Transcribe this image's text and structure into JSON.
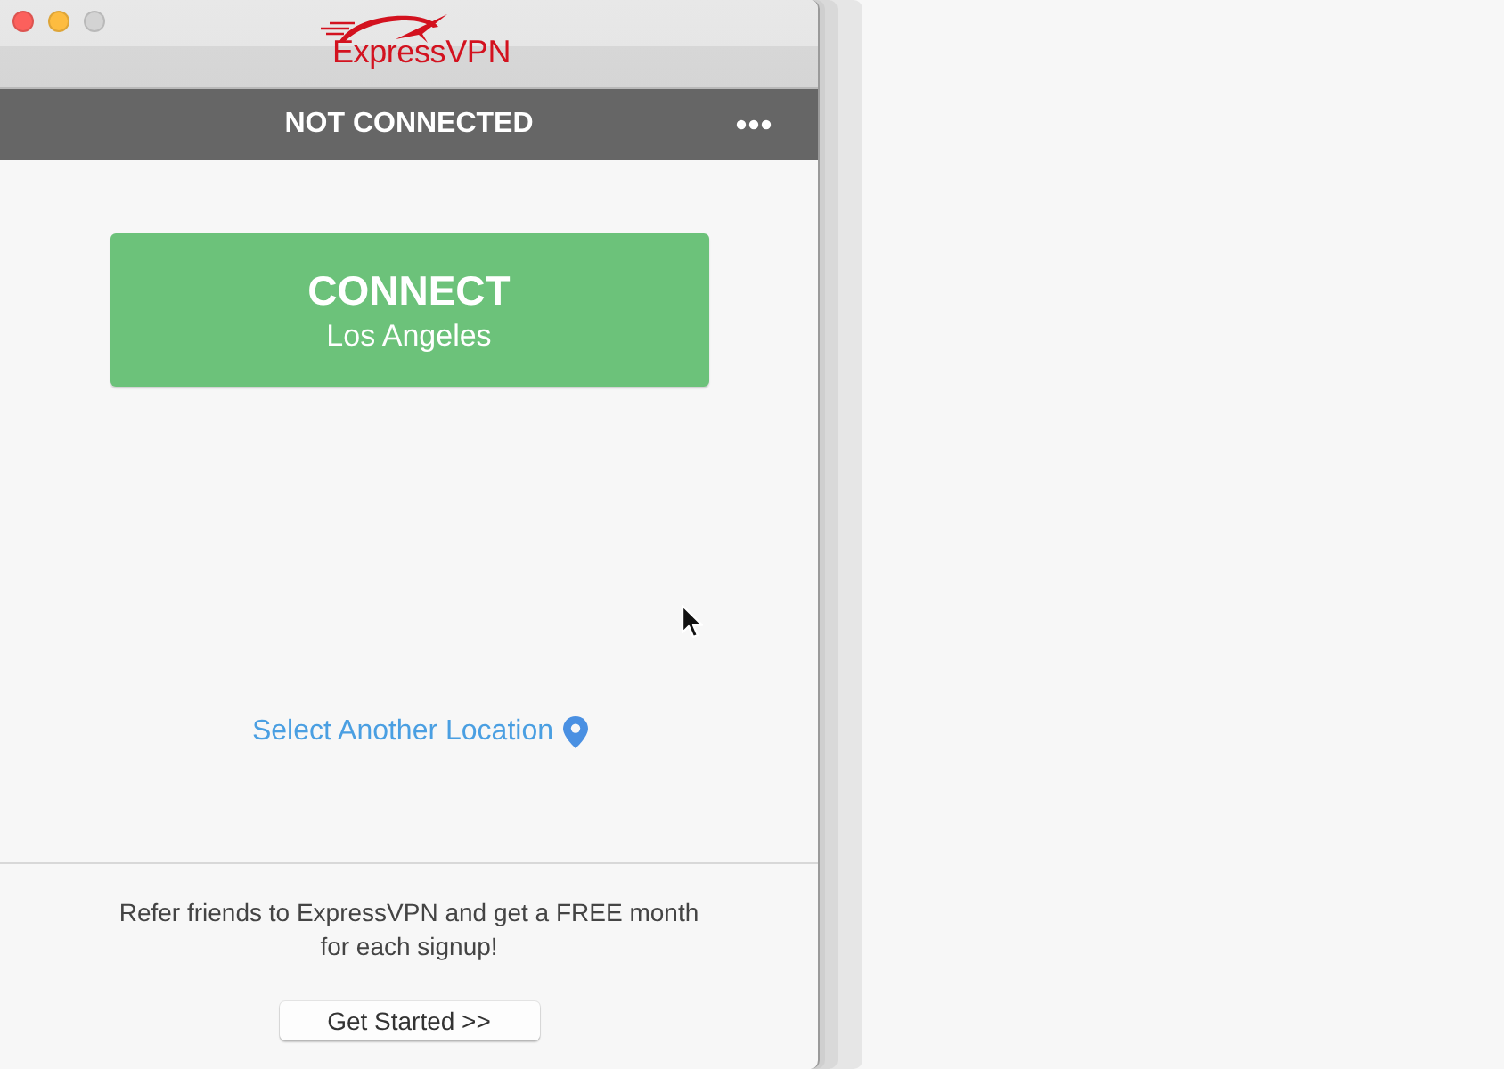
{
  "window": {
    "controls": [
      {
        "color": "#fc605c"
      },
      {
        "color": "#fdbc40"
      },
      {
        "color": "#d3d3d3"
      }
    ],
    "logo": {
      "text": "ExpressVPN"
    }
  },
  "status_bar": {
    "label": "NOT CONNECTED"
  },
  "connect_button": {
    "label": "CONNECT",
    "location": "Los Angeles"
  },
  "location_link": {
    "label": "Select Another Location"
  },
  "referral": {
    "text": "Refer friends to ExpressVPN and get a FREE month for each signup!",
    "button": "Get Started >>"
  }
}
